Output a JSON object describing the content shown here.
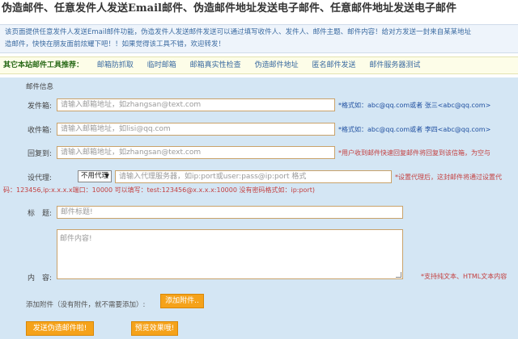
{
  "page": {
    "title": "伪造邮件、任意发件人发送Email邮件、伪造邮件地址发送电子邮件、任意邮件地址发送电子邮件"
  },
  "intro": {
    "line1": "该页面提供任意发件人发送Email邮件功能，伪造发件人发送邮件发送可以通过填写收件人、发件人、邮件主题、邮件内容！给对方发送一封来自某某地址",
    "line2": "造邮件，快快在朋友面前炫耀下吧！！如果觉得该工具不错，欢迎转发！"
  },
  "tools": {
    "label": "其它本站邮件工具推荐：",
    "links": [
      "邮箱防抓取",
      "临时邮箱",
      "邮箱真实性检查",
      "伪造邮件地址",
      "匿名邮件发送",
      "邮件服务器测试"
    ]
  },
  "form": {
    "section_title": "邮件信息",
    "from": {
      "label": "发件箱:",
      "placeholder": "请输入邮箱地址，如zhangsan@text.com",
      "note": "*格式如：abc@qq.com或者 张三<abc@qq.com>"
    },
    "to": {
      "label": "收件箱:",
      "placeholder": "请输入邮箱地址，如lisi@qq.com",
      "note": "*格式如：abc@qq.com或者 李四<abc@qq.com>"
    },
    "reply": {
      "label": "回复到:",
      "placeholder": "请输入邮箱地址，如zhangsan@text.com",
      "note": "*用户收到邮件快速回复邮件将回复到该信箱，为空与"
    },
    "proxy": {
      "label": "设代理:",
      "select_value": "不用代理",
      "placeholder": "请输入代理服务器，如ip:port或user:pass@ip:port 格式",
      "note": "*设置代理后，这封邮件将通过设置代",
      "example": "码：123456,ip:x.x.x.x端口：10000 可以填写：test:123456@x.x.x.x:10000 没有密码格式如：ip:port)"
    },
    "subject": {
      "label": "标　题:",
      "placeholder": "邮件标题!"
    },
    "content": {
      "label": "内　容:",
      "placeholder": "邮件内容!",
      "note": "*支持纯文本、HTML文本内容"
    },
    "attachment": {
      "label": "添加附件（没有附件，就不需要添加）:",
      "button": "添加附件.."
    },
    "send_button": "发送伪造邮件啦!",
    "preview_button": "预览效果哦!"
  },
  "colors": {
    "accent_button": "#f5a21a",
    "form_background": "#d4e6f4",
    "note_red": "#c44040",
    "input_border": "#c9a26a"
  }
}
